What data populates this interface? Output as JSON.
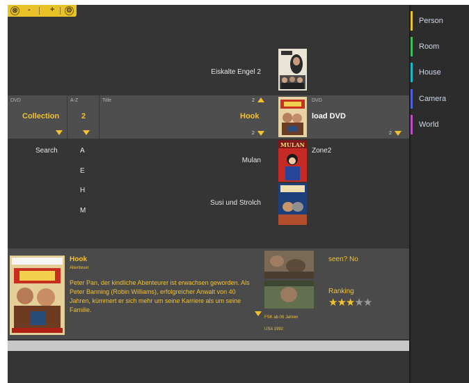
{
  "window_controls": {
    "close": "⊗",
    "minimize": "-",
    "maximize": "+",
    "settings": "⚙"
  },
  "sidebar": {
    "items": [
      {
        "label": "Person",
        "color": "#e8c227"
      },
      {
        "label": "Room",
        "color": "#3fbf5f"
      },
      {
        "label": "House",
        "color": "#1fb5c9"
      },
      {
        "label": "Camera",
        "color": "#4f63d8"
      },
      {
        "label": "World",
        "color": "#c24fc9"
      }
    ]
  },
  "list_above": {
    "title": "Eiskalte Engel 2"
  },
  "filters": {
    "source": {
      "header": "DVD",
      "value": "Collection"
    },
    "sort": {
      "header": "A-Z",
      "value": "2"
    },
    "title": {
      "header": "Title",
      "value": "Hook",
      "count_top": "2",
      "count_bottom": "2"
    },
    "device": {
      "header": "DVD",
      "value": "load DVD",
      "count": "2"
    }
  },
  "search_label": "Search",
  "letters": [
    "A",
    "E",
    "H",
    "M"
  ],
  "zone_label": "Zone2",
  "list_below": [
    {
      "title": "Mulan"
    },
    {
      "title": "Susi und Strolch"
    }
  ],
  "detail": {
    "title": "Hook",
    "genre": "Abenteuer",
    "description": "Peter Pan, der kindliche Abenteurer ist erwachsen geworden. Als Peter Banning (Robin Williams), erfolgreicher Anwalt von 40 Jahren, kümmert er sich mehr um seine Karriere als um seine Familie.",
    "fsk": "FSK ab 06 Jahren",
    "origin": "USA 1992",
    "seen": "seen? No",
    "ranking_label": "Ranking",
    "rating": 3,
    "rating_max": 5
  },
  "colors": {
    "accent": "#f2c230",
    "background": "#353535",
    "row_highlight": "#4e4e4e"
  }
}
